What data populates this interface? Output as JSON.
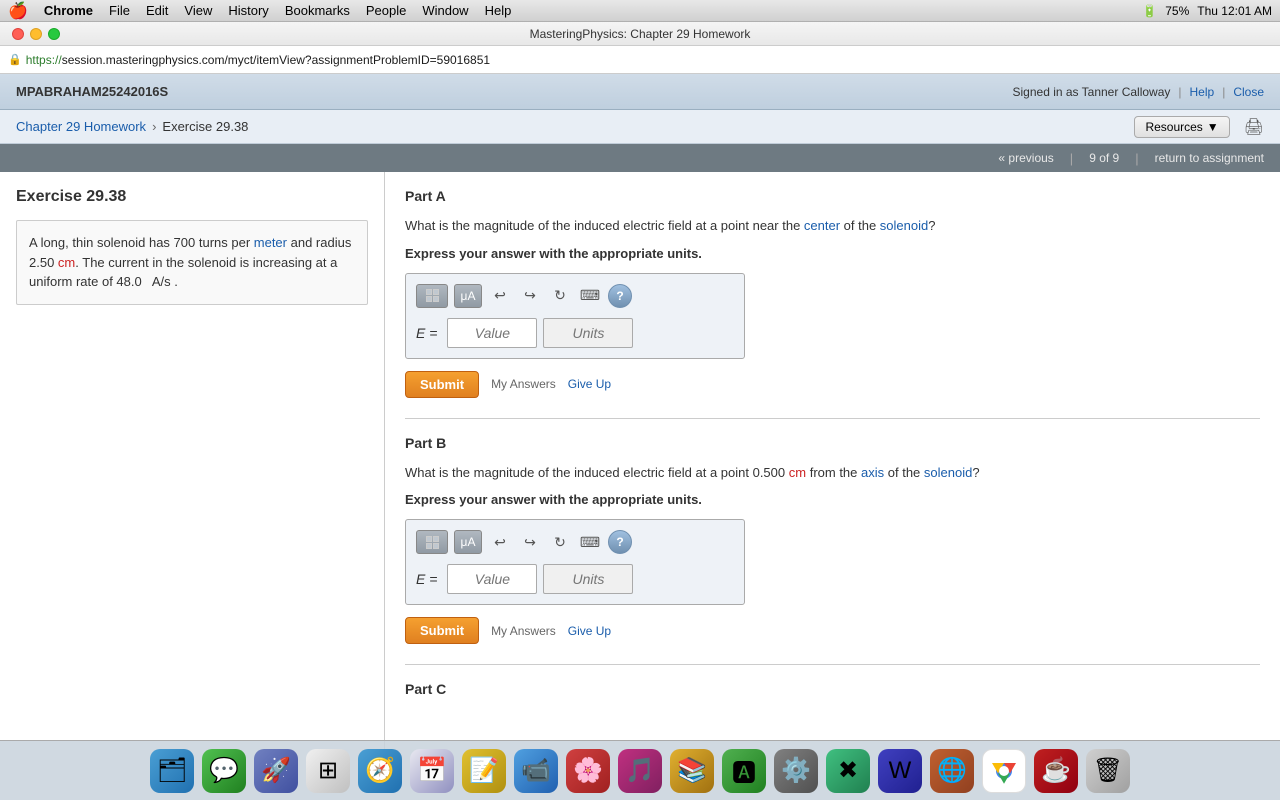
{
  "menubar": {
    "apple": "🍎",
    "items": [
      "Chrome",
      "File",
      "Edit",
      "View",
      "History",
      "Bookmarks",
      "People",
      "Window",
      "Help"
    ],
    "right": {
      "time": "Thu 12:01 AM",
      "battery": "75%"
    }
  },
  "browser": {
    "title": "MasteringPhysics: Chapter 29 Homework",
    "url_prefix": "https://",
    "url_host": "session.masteringphysics.com",
    "url_path": "/myct/itemView?assignmentProblemID=59016851"
  },
  "appheader": {
    "site_name": "MPABRAHAM25242016S",
    "signed_in_text": "Signed in as Tanner Calloway",
    "help_label": "Help",
    "close_label": "Close"
  },
  "breadcrumb": {
    "home": "Chapter 29 Homework",
    "current": "Exercise 29.38",
    "resources_label": "Resources",
    "print_icon": "🖨"
  },
  "navbar": {
    "previous": "« previous",
    "page_count": "9 of 9",
    "return": "return to assignment"
  },
  "sidebar": {
    "title": "Exercise 29.38",
    "problem_text": "A long, thin solenoid has 700 turns per meter and radius 2.50 cm. The current in the solenoid is increasing at a uniform rate of 48.0  A/s ."
  },
  "partA": {
    "title": "Part A",
    "question": "What is the magnitude of the induced electric field at a point near the center of the solenoid?",
    "instruction": "Express your answer with the appropriate units.",
    "eq_label": "E =",
    "value_placeholder": "Value",
    "units_placeholder": "Units",
    "submit_label": "Submit",
    "my_answers": "My Answers",
    "give_up": "Give Up"
  },
  "partB": {
    "title": "Part B",
    "question": "What is the magnitude of the induced electric field at a point 0.500 cm from the axis of the solenoid?",
    "instruction": "Express your answer with the appropriate units.",
    "eq_label": "E =",
    "value_placeholder": "Value",
    "units_placeholder": "Units",
    "submit_label": "Submit",
    "my_answers": "My Answers",
    "give_up": "Give Up"
  },
  "partC": {
    "title": "Part C"
  },
  "toolbar": {
    "grid_icon": "▦",
    "mu_icon": "μA",
    "undo_icon": "↩",
    "redo_icon": "↪",
    "refresh_icon": "↻",
    "keyboard_icon": "⌨",
    "help_icon": "?"
  }
}
